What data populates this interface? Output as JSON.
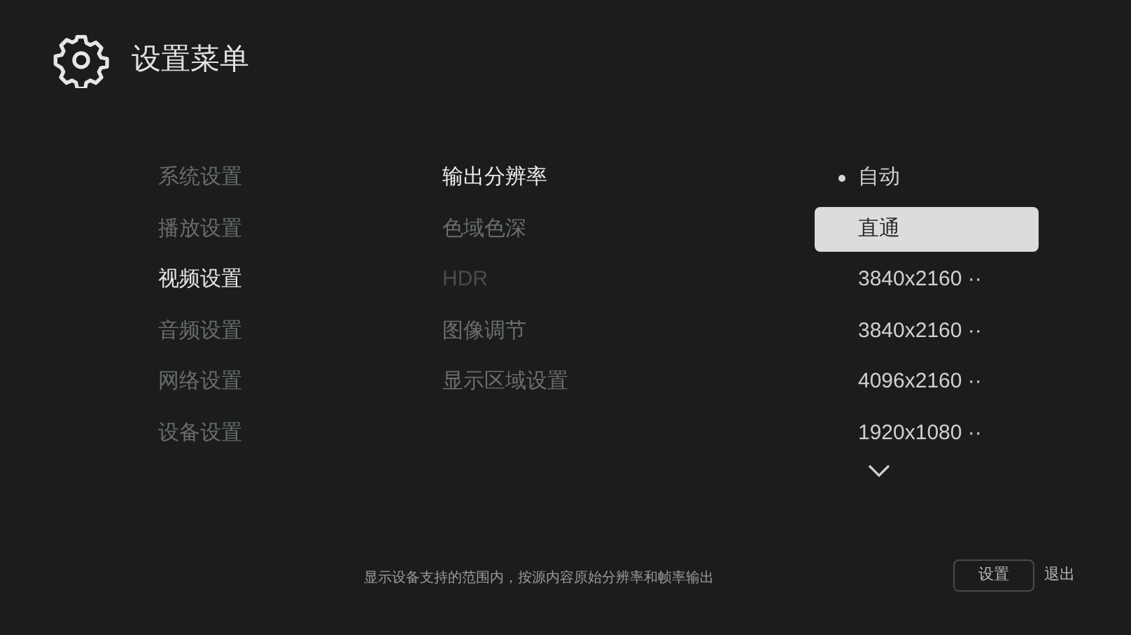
{
  "header": {
    "title": "设置菜单"
  },
  "categories": [
    {
      "label": "系统设置",
      "selected": false
    },
    {
      "label": "播放设置",
      "selected": false
    },
    {
      "label": "视频设置",
      "selected": true
    },
    {
      "label": "音频设置",
      "selected": false
    },
    {
      "label": "网络设置",
      "selected": false
    },
    {
      "label": "设备设置",
      "selected": false
    }
  ],
  "options": [
    {
      "label": "输出分辨率",
      "selected": true,
      "disabled": false
    },
    {
      "label": "色域色深",
      "selected": false,
      "disabled": false
    },
    {
      "label": "HDR",
      "selected": false,
      "disabled": true
    },
    {
      "label": "图像调节",
      "selected": false,
      "disabled": false
    },
    {
      "label": "显示区域设置",
      "selected": false,
      "disabled": false
    }
  ],
  "values": [
    {
      "label": "自动",
      "checked": true,
      "selected": false
    },
    {
      "label": "直通",
      "checked": false,
      "selected": true
    },
    {
      "label": "3840x2160 ··",
      "checked": false,
      "selected": false
    },
    {
      "label": "3840x2160 ··",
      "checked": false,
      "selected": false
    },
    {
      "label": "4096x2160 ··",
      "checked": false,
      "selected": false
    },
    {
      "label": "1920x1080 ··",
      "checked": false,
      "selected": false
    }
  ],
  "footer": {
    "hint": "显示设备支持的范围内，按源内容原始分辨率和帧率输出",
    "buttons": [
      {
        "label": "设置",
        "kind": "boxed"
      },
      {
        "label": "退出",
        "kind": "plain"
      }
    ]
  }
}
